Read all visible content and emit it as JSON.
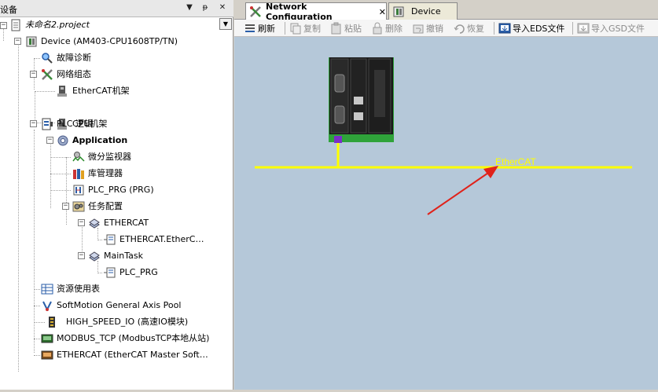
{
  "left_panel": {
    "title": "设备",
    "pin_label": "▼",
    "pin2_label": "ᵽ",
    "close_label": "✕",
    "dropdown_label": "▼"
  },
  "tree": {
    "project": "未命名2.project",
    "device": "Device (AM403-CPU1608TP/TN)",
    "diag": "故障诊断",
    "network": "网络组态",
    "ethercat_rack": "EtherCAT机架",
    "cpu_rack": "CPU机架",
    "plc_logic": "PLC 逻辑",
    "application": "Application",
    "monitor": "微分监视器",
    "lib_manager": "库管理器",
    "plc_prg": "PLC_PRG (PRG)",
    "task_config": "任务配置",
    "ethercat_task": "ETHERCAT",
    "ethercat_call": "ETHERCAT.EtherC…",
    "main_task": "MainTask",
    "main_call": "PLC_PRG",
    "resource_table": "资源使用表",
    "softmotion": "SoftMotion General Axis Pool",
    "high_speed_io": "HIGH_SPEED_IO (高速IO模块)",
    "modbus_tcp": "MODBUS_TCP (ModbusTCP本地从站)",
    "ethercat_master": "ETHERCAT (EtherCAT Master Soft…"
  },
  "tabs": {
    "network_config": "Network Configuration",
    "close_glyph": "✕",
    "device": "Device"
  },
  "toolbar": {
    "refresh": "刷新",
    "copy": "复制",
    "paste": "粘贴",
    "delete": "删除",
    "undo": "撤销",
    "redo": "恢复",
    "import_eds": "导入EDS文件",
    "import_gsd": "导入GSD文件"
  },
  "canvas": {
    "bus_label": "EtherCAT",
    "colors": {
      "background": "#b5c8d9",
      "bus": "#ffff00",
      "bus_label": "#ffff00",
      "arrow": "#e0221a",
      "plc_base": "#2fa33a",
      "plc_body": "#1a1a1a",
      "port": "#7a2fc8"
    }
  }
}
